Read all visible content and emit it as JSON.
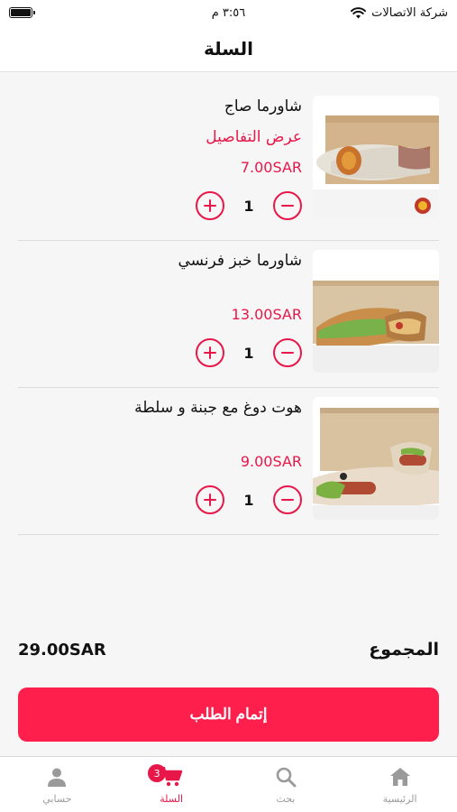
{
  "status_bar": {
    "carrier": "شركة الاتصالات",
    "time": "٣:٥٦ م"
  },
  "header": {
    "title": "السلة"
  },
  "cart": {
    "details_label": "عرض التفاصيل",
    "items": [
      {
        "name": "شاورما صاج",
        "price": "7.00SAR",
        "quantity": "1"
      },
      {
        "name": "شاورما خبز فرنسي",
        "price": "13.00SAR",
        "quantity": "1"
      },
      {
        "name": "هوت دوغ مع جبنة و سلطة",
        "price": "9.00SAR",
        "quantity": "1"
      }
    ]
  },
  "summary": {
    "total_label": "المجموع",
    "total_amount": "29.00SAR"
  },
  "checkout": {
    "label": "إتمام الطلب"
  },
  "tabbar": {
    "tabs": [
      {
        "label": "الرئيسية",
        "icon": "home-icon"
      },
      {
        "label": "بحث",
        "icon": "search-icon"
      },
      {
        "label": "السلة",
        "icon": "cart-icon",
        "badge": "3"
      },
      {
        "label": "حسابي",
        "icon": "user-icon"
      }
    ]
  },
  "colors": {
    "accent": "#e8174a",
    "checkout_bg": "#ff1f4d",
    "background": "#f6f6f6"
  }
}
